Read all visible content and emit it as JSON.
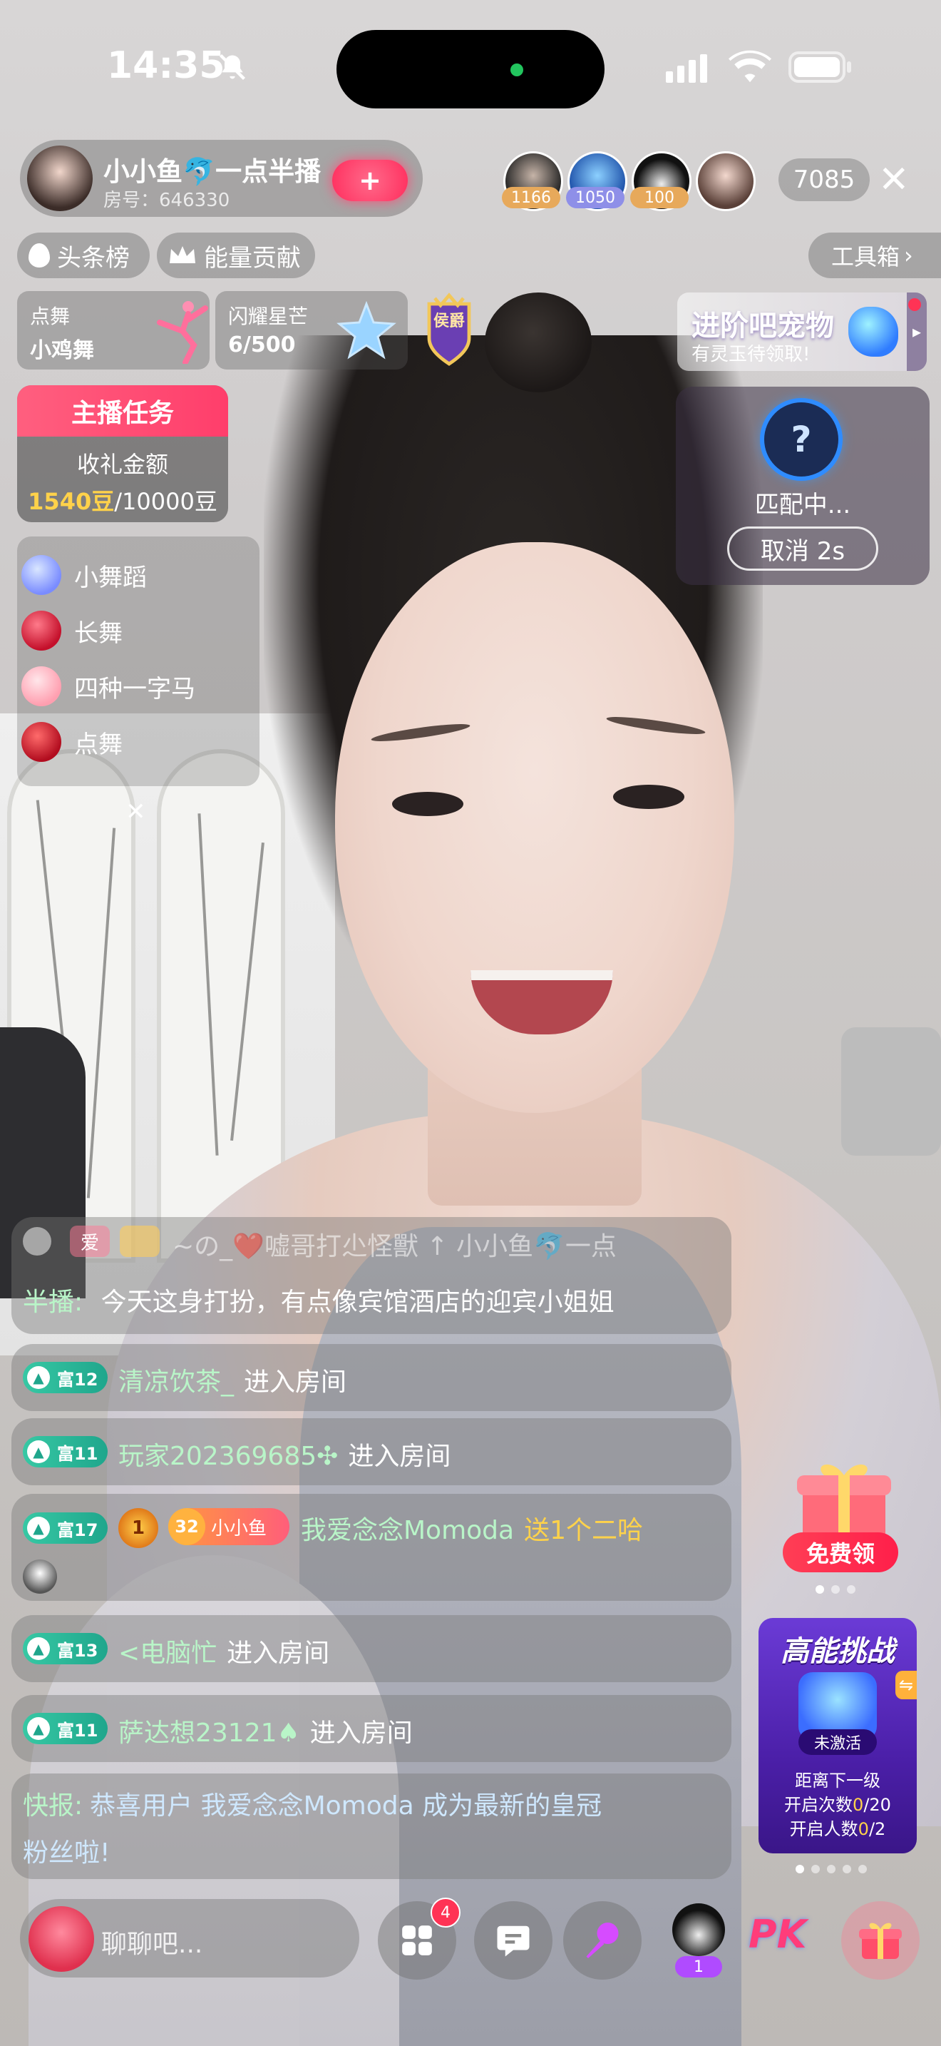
{
  "status_bar": {
    "time": "14:35"
  },
  "host": {
    "name": "小小鱼🐬一点半播",
    "room_no": "房号：646330",
    "follow_label": "+"
  },
  "viewers": {
    "top": [
      {
        "badge": "1166",
        "badge_color": "#e7a95b"
      },
      {
        "badge": "1050",
        "badge_color": "#8e8fe8"
      },
      {
        "badge": "100",
        "badge_color": "#e7a95b"
      },
      {
        "badge": "",
        "badge_color": ""
      }
    ],
    "count": "7085",
    "close": "✕"
  },
  "chips": {
    "headline": "头条榜",
    "energy": "能量贡献",
    "toolbox": "工具箱"
  },
  "cards": {
    "dance_l1": "点舞",
    "dance_l2": "小鸡舞",
    "star_l1": "闪耀星芒",
    "star_l2": "6/500",
    "rank_badge": "侯爵"
  },
  "pet_banner": {
    "title": "进阶吧宠物",
    "subtitle": "有灵玉待领取!"
  },
  "task": {
    "title": "主播任务",
    "label": "收礼金额",
    "current": "1540豆",
    "target": "/10000豆"
  },
  "match": {
    "status": "匹配中...",
    "cancel": "取消 2s",
    "question": "?"
  },
  "gift_list": {
    "items": [
      "小舞蹈",
      "长舞",
      "四种一字马",
      "点舞"
    ],
    "close": "✕"
  },
  "chat": {
    "msg1_badge_ai": "爱",
    "msg1_text_faded": "~の_❤️嘘哥打尐怪獸 ↑ 小小鱼🐬一点",
    "msg1_name": "半播:",
    "msg1_text": "今天这身打扮，有点像宾馆酒店的迎宾小姐姐",
    "rows": [
      {
        "level": "富12",
        "user": "清凉饮茶_",
        "action": "进入房间"
      },
      {
        "level": "富11",
        "user": "玩家202369685✣",
        "action": "进入房间"
      }
    ],
    "gift_msg": {
      "level": "富17",
      "rank": "1",
      "fan_level": "32",
      "fan_name": "小小鱼",
      "user": "我爱念念Momoda",
      "action": "送1个二哈"
    },
    "rows2": [
      {
        "level": "富13",
        "user": "<电脑忙",
        "action": "进入房间"
      },
      {
        "level": "富11",
        "user": "萨达想23121♠",
        "action": "进入房间"
      }
    ],
    "flash_label": "快报:",
    "flash_text1": "恭喜用户 我爱念念Momoda 成为最新的皇冠",
    "flash_text2": "粉丝啦!"
  },
  "promo": {
    "free_label": "免费领",
    "challenge_title": "高能挑战",
    "challenge_state": "未激活",
    "challenge_l1": "距离下一级",
    "challenge_l2a": "开启次数",
    "challenge_l2b": "0",
    "challenge_l2c": "/20",
    "challenge_l3a": "开启人数",
    "challenge_l3b": "0",
    "challenge_l3c": "/2"
  },
  "bottom": {
    "chat_placeholder": "聊聊吧...",
    "apps_badge": "4",
    "guest_badge": "1",
    "pk": "PK"
  },
  "colors": {
    "accent_pink": "#ff3e6b",
    "level_green": "#1fa68c",
    "gold": "#ffd24a",
    "username_green": "#b9f5c8"
  }
}
